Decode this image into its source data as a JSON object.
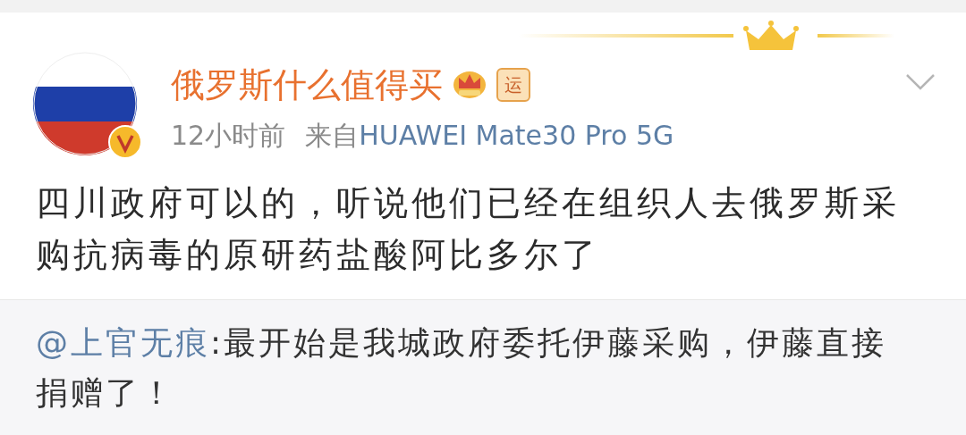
{
  "post": {
    "author": "俄罗斯什么值得买",
    "badge": "运",
    "verified": true,
    "time": "12小时前",
    "source_prefix": "来自",
    "source": "HUAWEI Mate30 Pro 5G",
    "text": "四川政府可以的，听说他们已经在组织人去俄罗斯采购抗病毒的原研药盐酸阿比多尔了"
  },
  "repost": {
    "mention": "@上官无痕",
    "text": ":最开始是我城政府委托伊藤采购，伊藤直接捐赠了！"
  }
}
